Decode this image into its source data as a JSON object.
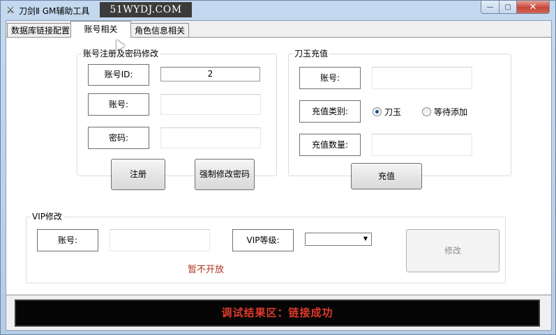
{
  "window": {
    "title": "刀剑Ⅱ GM辅助工具",
    "watermark": "51WYDJ.COM",
    "controls": {
      "minimize": "—",
      "maximize": "▢",
      "close": "✕"
    }
  },
  "tabs": [
    {
      "label": "数据库链接配置",
      "active": false
    },
    {
      "label": "账号相关",
      "active": true
    },
    {
      "label": "角色信息相关",
      "active": false
    }
  ],
  "account_group": {
    "title": "账号注册及密码修改",
    "id_label": "账号ID:",
    "id_value": "2",
    "account_label": "账号:",
    "account_value": "",
    "password_label": "密码:",
    "password_value": "",
    "register_button": "注册",
    "force_reset_button": "强制修改密码"
  },
  "recharge_group": {
    "title": "刀玉充值",
    "account_label": "账号:",
    "account_value": "",
    "type_label": "充值类别:",
    "type_options": [
      {
        "label": "刀玉",
        "selected": true
      },
      {
        "label": "等待添加",
        "selected": false
      }
    ],
    "amount_label": "充值数量:",
    "amount_value": "",
    "recharge_button": "充值"
  },
  "vip_group": {
    "title": "VIP修改",
    "account_label": "账号:",
    "account_value": "",
    "level_label": "VIP等级:",
    "level_value": "",
    "modify_button": "修改",
    "notice": "暂不开放"
  },
  "result": {
    "text": "调试结果区：链接成功"
  },
  "colors": {
    "result_text": "#e03a2a",
    "notice_text": "#b3331f",
    "title_bar": "#c4d9ef",
    "close_button": "#c7473a"
  },
  "icons": {
    "app": "sword-icon",
    "cursor": "mouse-pointer-icon"
  }
}
